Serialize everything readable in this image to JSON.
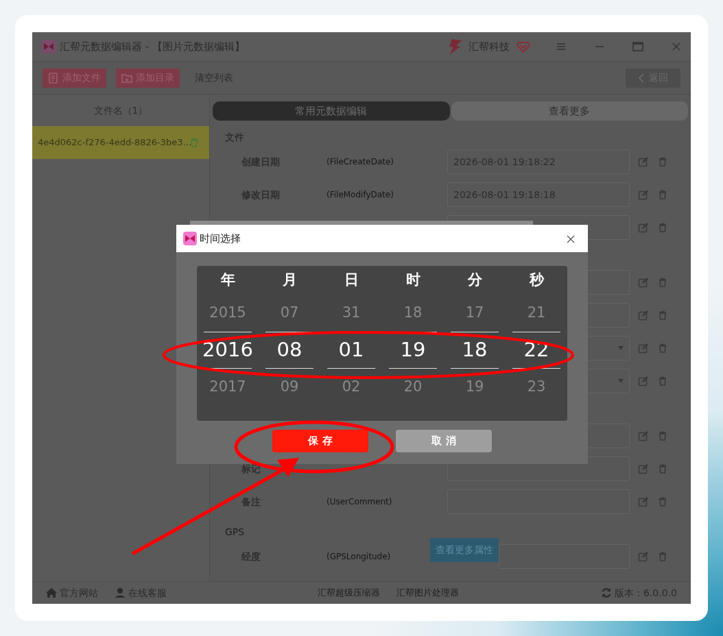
{
  "window": {
    "title": "汇帮元数据编辑器 - 【图片元数据编辑】",
    "brand": "汇帮科技"
  },
  "toolbar": {
    "buttons": [
      {
        "label": "添加文件",
        "kind": "file"
      },
      {
        "label": "添加目录",
        "kind": "folder"
      }
    ],
    "clear_link": "清空列表",
    "back_button": "返回"
  },
  "sidebar": {
    "header": "文件名（1）",
    "files": [
      {
        "name": "4e4d062c-f276-4edd-8826-3be3…",
        "selected": true
      }
    ]
  },
  "tabs": [
    {
      "label": "常用元数据编辑",
      "selected": true
    },
    {
      "label": "查看更多",
      "selected": false
    }
  ],
  "sections": [
    {
      "title": "文件",
      "rows": [
        {
          "label": "创建日期",
          "tag": "(FileCreateDate)",
          "value": "2026-08-01 19:18:22",
          "kind": "text"
        },
        {
          "label": "修改日期",
          "tag": "(FileModifyDate)",
          "value": "2026-08-01 19:18:18",
          "kind": "text"
        },
        {
          "kind": "text"
        }
      ]
    },
    {
      "rows": [
        {
          "kind": "text"
        },
        {
          "kind": "text"
        },
        {
          "kind": "dropdown"
        },
        {
          "kind": "dropdown"
        }
      ]
    },
    {
      "rows": [
        {
          "kind": "text"
        },
        {
          "label": "标记",
          "kind": "text"
        },
        {
          "label": "备注",
          "tag": "(UserComment)",
          "kind": "text"
        }
      ]
    },
    {
      "title": "GPS",
      "rows": [
        {
          "label": "经度",
          "tag": "(GPSLongitude)",
          "kind": "text"
        }
      ]
    }
  ],
  "more_button": "查看更多属性",
  "status_bar": {
    "links": [
      {
        "label": "官方网站",
        "kind": "home"
      },
      {
        "label": "在线客服",
        "kind": "person"
      }
    ],
    "products": [
      "汇帮超级压缩器",
      "汇帮图片处理器"
    ],
    "version": "版本：6.0.0.0"
  },
  "dialog": {
    "title": "时间选择",
    "columns": [
      {
        "header": "年",
        "prev": "2015",
        "value": "2016",
        "next": "2017"
      },
      {
        "header": "月",
        "prev": "07",
        "value": "08",
        "next": "09"
      },
      {
        "header": "日",
        "prev": "31",
        "value": "01",
        "next": "02"
      },
      {
        "header": "时",
        "prev": "18",
        "value": "19",
        "next": "20"
      },
      {
        "header": "分",
        "prev": "17",
        "value": "18",
        "next": "19"
      },
      {
        "header": "秒",
        "prev": "21",
        "value": "22",
        "next": "23"
      }
    ],
    "buttons": [
      {
        "label": "保 存",
        "kind": "primary"
      },
      {
        "label": "取 消",
        "kind": "secondary"
      }
    ]
  }
}
